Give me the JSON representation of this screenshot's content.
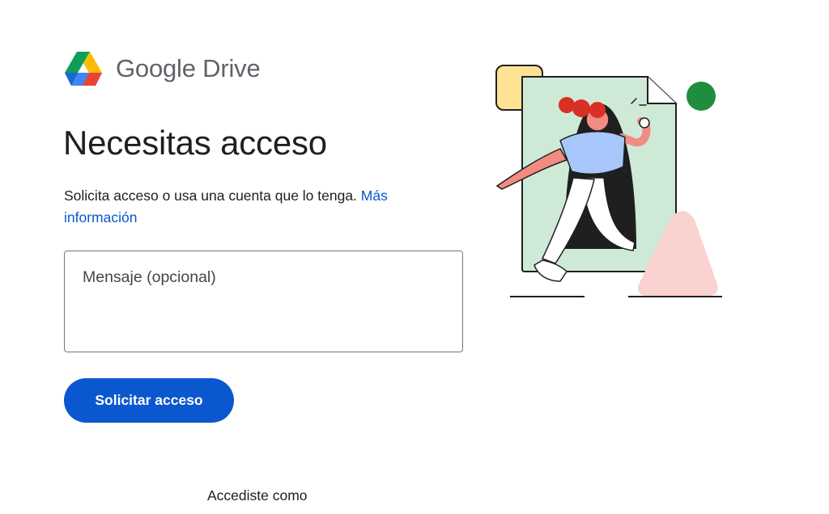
{
  "brand": {
    "product_name": "Google Drive",
    "logo_icon": "google-drive-logo",
    "colors": {
      "green": "#0f9d58",
      "blue": "#4285f4",
      "yellow": "#fbbc04",
      "red": "#ea4335"
    }
  },
  "main": {
    "title": "Necesitas acceso",
    "description": "Solicita acceso o usa una cuenta que lo tenga. ",
    "learn_more_link": "Más información",
    "message_field": {
      "placeholder": "Mensaje (opcional)",
      "value": ""
    },
    "request_button": "Solicitar acceso",
    "signed_in_label": "Accediste como"
  },
  "illustration": {
    "icon": "person-stepping-through-document-illustration",
    "colors": {
      "document": "#ceead6",
      "yellow_square": "#fde293",
      "green_circle": "#1e8e3e",
      "pink_triangle": "#fad2cf",
      "hair": "#d93025",
      "shirt": "#a8c7fa",
      "skin": "#f28b82"
    }
  },
  "theme": {
    "accent": "#0b57d0",
    "text": "#1f1f1f",
    "muted": "#5f6368",
    "border": "#747775"
  }
}
